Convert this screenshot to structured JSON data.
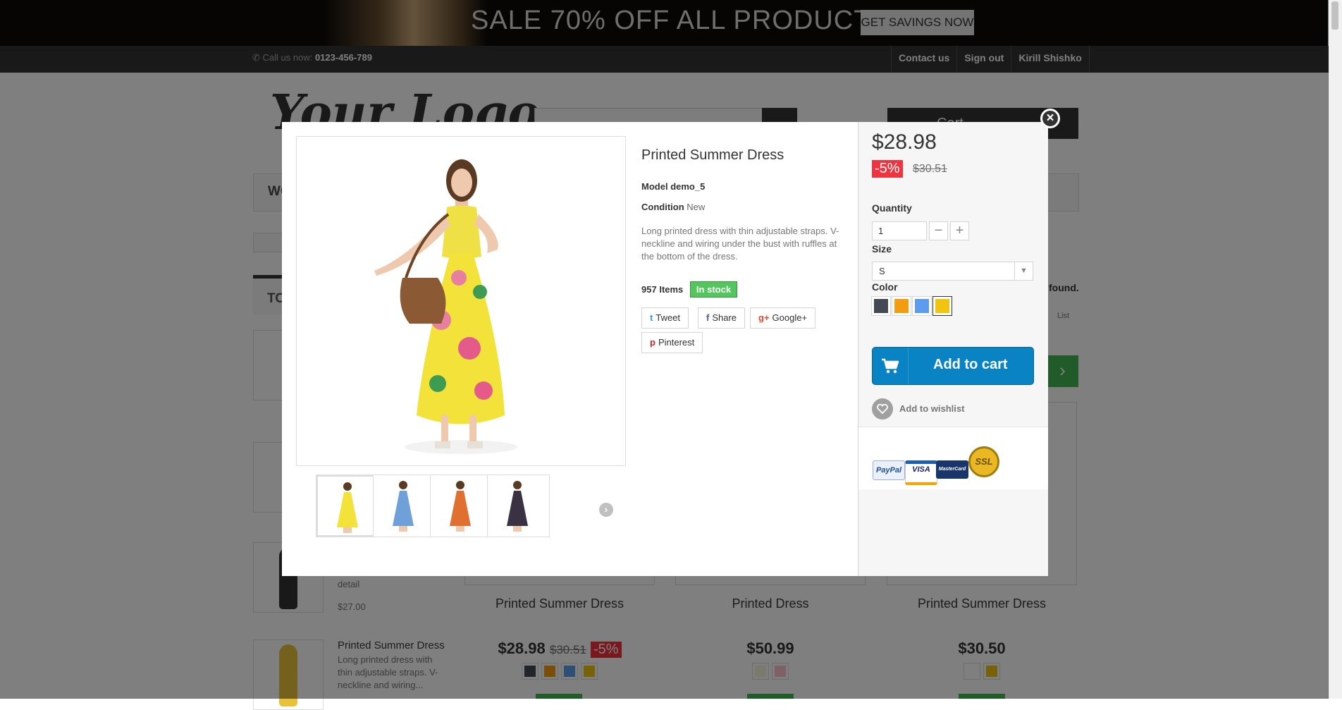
{
  "banner": {
    "headline": "SALE 70% OFF ALL PRODUCTS",
    "cta": "GET SAVINGS NOW"
  },
  "topbar": {
    "call_label": "Call us now:",
    "phone": "0123-456-789",
    "links": [
      "Contact us",
      "Sign out",
      "Kirill Shishko"
    ]
  },
  "header": {
    "logo": "Your Logo",
    "cart_label": "Cart",
    "menu_item": "WO"
  },
  "left_column": {
    "block_title": "TO",
    "items": [
      {
        "desc": "detail",
        "price": "$27.00"
      },
      {
        "name": "Printed Summer Dress",
        "desc": "Long printed dress with thin adjustable straps. V-neckline and wiring..."
      }
    ]
  },
  "listing": {
    "found_text": "found.",
    "list_label": "List",
    "products": [
      {
        "name": "Printed Summer Dress",
        "price": "$28.98",
        "old_price": "$30.51",
        "discount": "-5%",
        "swatches": [
          "#434a54",
          "#f39c11",
          "#5d9cec",
          "#f1c40f"
        ]
      },
      {
        "name": "Printed Dress",
        "price": "$50.99",
        "swatches": [
          "#f5f5dc",
          "#fcc0cb"
        ]
      },
      {
        "name": "Printed Summer Dress",
        "price": "$30.50",
        "swatches": [
          "#ffffff",
          "#f1c40f"
        ]
      }
    ]
  },
  "quick_view": {
    "title": "Printed Summer Dress",
    "model_label": "Model",
    "model": "demo_5",
    "condition_label": "Condition",
    "condition": "New",
    "description": "Long printed dress with thin adjustable straps. V-neckline and wiring under the bust with ruffles at the bottom of the dress.",
    "quantity_available": "957",
    "items_label": "Items",
    "stock_status": "In stock",
    "social": [
      {
        "icon": "twitter-icon",
        "glyph": "t",
        "label": "Tweet"
      },
      {
        "icon": "facebook-icon",
        "glyph": "f",
        "label": "Share"
      },
      {
        "icon": "google-plus-icon",
        "glyph": "g+",
        "label": "Google+"
      },
      {
        "icon": "pinterest-icon",
        "glyph": "p",
        "label": "Pinterest"
      }
    ],
    "price": "$28.98",
    "discount": "-5%",
    "old_price": "$30.51",
    "quantity_label": "Quantity",
    "quantity_value": "1",
    "size_label": "Size",
    "size_value": "S",
    "color_label": "Color",
    "colors": [
      "#434a54",
      "#f39c11",
      "#5d9cec",
      "#f1c40f"
    ],
    "selected_color_index": 3,
    "add_to_cart": "Add to cart",
    "wishlist": "Add to wishlist",
    "payment_cards": [
      "PayPal",
      "VISA",
      "MasterCard",
      "SSL"
    ],
    "thumbnail_dress_colors": [
      "#f3e23a",
      "#6fa0d8",
      "#e0702f",
      "#3a3142"
    ]
  },
  "colors": {
    "accent": "#0a83c4",
    "stock_green": "#55c65e",
    "discount_red": "#f13340",
    "dark": "#333333"
  }
}
